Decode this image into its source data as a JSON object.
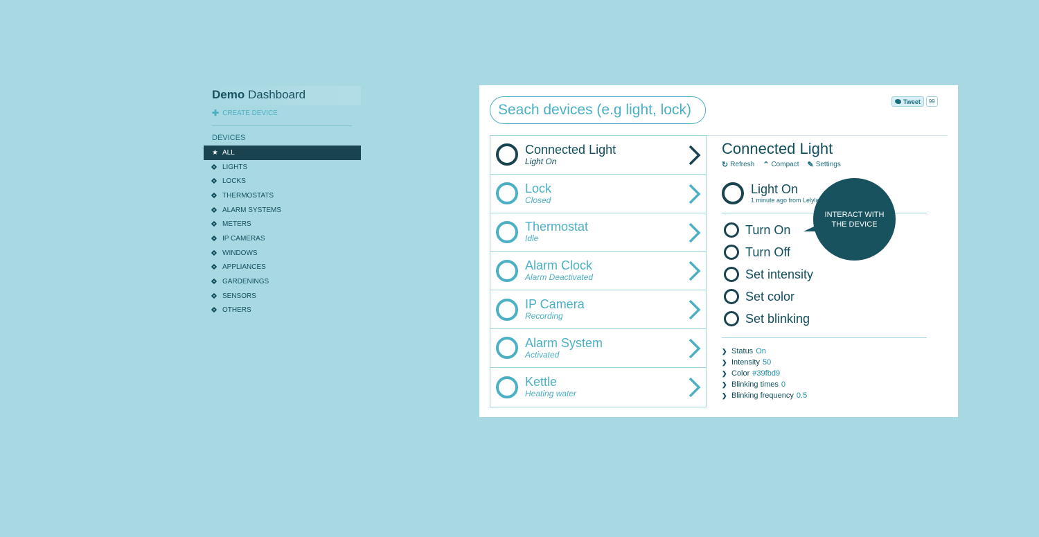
{
  "sidebar": {
    "brand_bold": "Demo",
    "brand_rest": "Dashboard",
    "create_label": "CREATE DEVICE",
    "section_title": "DEVICES",
    "items": [
      {
        "label": "ALL",
        "icon": "star-icon",
        "active": true
      },
      {
        "label": "LIGHTS",
        "icon": "tag-icon"
      },
      {
        "label": "LOCKS",
        "icon": "tag-icon"
      },
      {
        "label": "THERMOSTATS",
        "icon": "tag-icon"
      },
      {
        "label": "ALARM SYSTEMS",
        "icon": "tag-icon"
      },
      {
        "label": "METERS",
        "icon": "tag-icon"
      },
      {
        "label": "IP CAMERAS",
        "icon": "tag-icon"
      },
      {
        "label": "WINDOWS",
        "icon": "tag-icon"
      },
      {
        "label": "APPLIANCES",
        "icon": "tag-icon"
      },
      {
        "label": "GARDENINGS",
        "icon": "tag-icon"
      },
      {
        "label": "SENSORS",
        "icon": "tag-icon"
      },
      {
        "label": "OTHERS",
        "icon": "tag-icon"
      }
    ]
  },
  "search": {
    "placeholder": "Seach devices (e.g light, lock)"
  },
  "tweet": {
    "label": "Tweet",
    "count": "99"
  },
  "devices": [
    {
      "name": "Connected Light",
      "status": "Light On",
      "selected": true
    },
    {
      "name": "Lock",
      "status": "Closed"
    },
    {
      "name": "Thermostat",
      "status": "Idle"
    },
    {
      "name": "Alarm Clock",
      "status": "Alarm Deactivated"
    },
    {
      "name": "IP Camera",
      "status": "Recording"
    },
    {
      "name": "Alarm System",
      "status": "Activated"
    },
    {
      "name": "Kettle",
      "status": "Heating water"
    }
  ],
  "detail": {
    "title": "Connected Light",
    "tools": {
      "refresh": "Refresh",
      "compact": "Compact",
      "settings": "Settings"
    },
    "state_title": "Light On",
    "state_sub": "1 minute ago from Lelylan",
    "actions": [
      "Turn On",
      "Turn Off",
      "Set intensity",
      "Set color",
      "Set blinking"
    ],
    "properties": [
      {
        "key": "Status",
        "value": "On"
      },
      {
        "key": "Intensity",
        "value": "50"
      },
      {
        "key": "Color",
        "value": "#39fbd9"
      },
      {
        "key": "Blinking times",
        "value": "0"
      },
      {
        "key": "Blinking frequency",
        "value": "0.5"
      }
    ]
  },
  "tooltip": {
    "text": "INTERACT WITH THE DEVICE"
  },
  "colors": {
    "background": "#a8d9e3",
    "accent": "#4cb0c5",
    "dark": "#19444f",
    "text_dark": "#124f5d"
  }
}
